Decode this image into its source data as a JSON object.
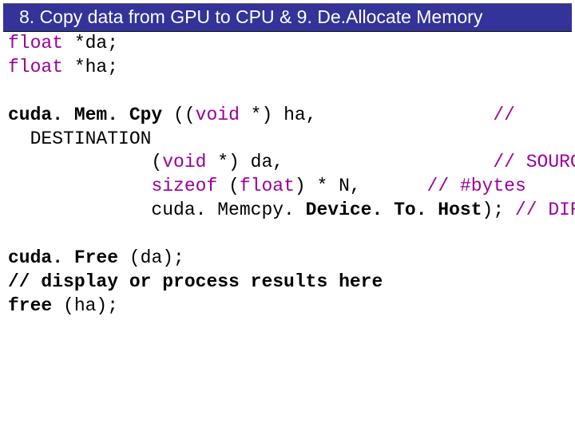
{
  "title": "8. Copy data from GPU to CPU & 9. De.Allocate Memory",
  "code": {
    "l1a": "float",
    "l1b": " *da;",
    "l2a": "float",
    "l2b": " *ha;",
    "blank1": "",
    "l3a": "cuda. Mem. Cpy",
    "l3b": " ((",
    "l3c": "void",
    "l3d": " *) ha,                ",
    "l3e": "//",
    "l4": "  DESTINATION",
    "l5a": "             (",
    "l5b": "void",
    "l5c": " *) da,                   ",
    "l5d": "// SOURCE",
    "l6a": "             ",
    "l6b": "sizeof",
    "l6c": " (",
    "l6d": "float",
    "l6e": ") * N,      ",
    "l6f": "// #bytes",
    "l7a": "             cuda. Memcpy. ",
    "l7b": "Device. To. Host",
    "l7c": "); ",
    "l7d": "// DIRECTION",
    "blank2": "",
    "l8a": "cuda. Free",
    "l8b": " (da);",
    "l9": "// display or process results here",
    "l10a": "free",
    "l10b": " (ha);"
  }
}
